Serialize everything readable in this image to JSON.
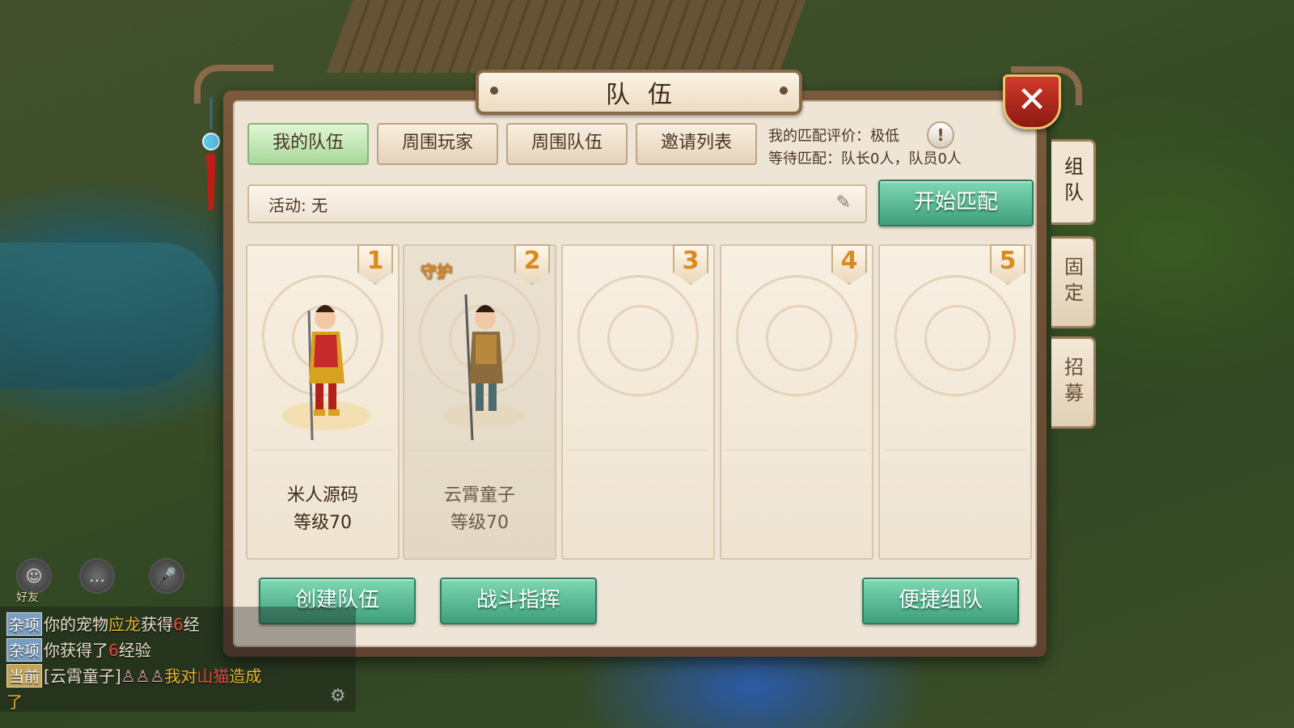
{
  "dialog": {
    "title": "队伍",
    "close_label": "✕",
    "tabs": [
      {
        "label": "我的队伍",
        "active": true
      },
      {
        "label": "周围玩家",
        "active": false
      },
      {
        "label": "周围队伍",
        "active": false
      },
      {
        "label": "邀请列表",
        "active": false
      }
    ],
    "match_rating": "我的匹配评价：极低",
    "match_waiting": "等待匹配：队长0人，队员0人",
    "info_icon": "!",
    "activity_label": "活动: 无",
    "start_match_label": "开始匹配",
    "side_tabs": [
      {
        "label": "组队",
        "active": true
      },
      {
        "label": "固定",
        "active": false
      },
      {
        "label": "招募",
        "active": false
      }
    ],
    "slots": [
      {
        "num": "1",
        "name": "米人源码",
        "level": "等级70",
        "tag": ""
      },
      {
        "num": "2",
        "name": "云霄童子",
        "level": "等级70",
        "tag": "守护"
      },
      {
        "num": "3",
        "name": "",
        "level": "",
        "tag": ""
      },
      {
        "num": "4",
        "name": "",
        "level": "",
        "tag": ""
      },
      {
        "num": "5",
        "name": "",
        "level": "",
        "tag": ""
      }
    ],
    "buttons": {
      "create_team": "创建队伍",
      "battle_command": "战斗指挥",
      "quick_team": "便捷组队"
    }
  },
  "hud": {
    "friend_label": "好友",
    "chat": [
      {
        "channel": "杂项",
        "parts": [
          "你的宠物",
          "应龙",
          "获得",
          "6",
          "经"
        ]
      },
      {
        "channel": "杂项",
        "parts": [
          "你获得了",
          "6",
          "经验"
        ]
      },
      {
        "channel": "当前",
        "parts": [
          "[云霄童子]",
          "我对",
          "山猫",
          "造成"
        ]
      },
      {
        "channel": "",
        "parts": [
          "了"
        ]
      }
    ]
  },
  "colors": {
    "accent_green": "#3f9f7c",
    "panel_bg": "#efe5d6",
    "close_red": "#d13a2a",
    "number_orange": "#d98b1f"
  },
  "icons": [
    "close-icon",
    "info-icon",
    "pencil-icon",
    "friend-icon",
    "chat-bubble-icon",
    "microphone-icon",
    "gear-icon"
  ]
}
